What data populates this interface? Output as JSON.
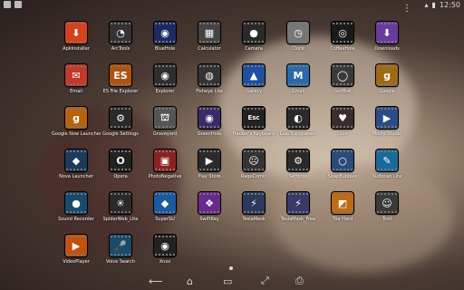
{
  "launcher": {
    "apps": [
      {
        "label": "ApkInstaller",
        "icon": "apk-installer-icon",
        "color": "#d4411a",
        "glyph": "⬇"
      },
      {
        "label": "ArcTools",
        "icon": "arc-tools-icon",
        "color": "#333333",
        "glyph": "◔"
      },
      {
        "label": "BlueHole",
        "icon": "blue-hole-icon",
        "color": "#1e2b63",
        "glyph": "◉"
      },
      {
        "label": "Calculator",
        "icon": "calculator-icon",
        "color": "#444444",
        "glyph": "▦"
      },
      {
        "label": "Camera",
        "icon": "camera-icon",
        "color": "#2a2a2a",
        "glyph": "●"
      },
      {
        "label": "Clock",
        "icon": "clock-icon",
        "color": "#777777",
        "glyph": "◷"
      },
      {
        "label": "CoffeeHole",
        "icon": "coffee-hole-icon",
        "color": "#1a1a1a",
        "glyph": "◎"
      },
      {
        "label": "Downloads",
        "icon": "downloads-icon",
        "color": "#6a3aa0",
        "glyph": "⬇"
      },
      {
        "label": "Email",
        "icon": "email-icon",
        "color": "#c0392b",
        "glyph": "✉"
      },
      {
        "label": "ES File Explorer",
        "icon": "es-file-explorer-icon",
        "color": "#b0520e",
        "glyph": "ES"
      },
      {
        "label": "Explorer",
        "icon": "explorer-icon",
        "color": "#2e2e2e",
        "glyph": "◉"
      },
      {
        "label": "Fisheye Lite",
        "icon": "fisheye-lite-icon",
        "color": "#333333",
        "glyph": "◍"
      },
      {
        "label": "Gallery",
        "icon": "gallery-icon",
        "color": "#1f4f9e",
        "glyph": "▲"
      },
      {
        "label": "Gmail",
        "icon": "gmail-icon",
        "color": "#2b6aa8",
        "glyph": "M"
      },
      {
        "label": "GolfBall",
        "icon": "golf-ball-icon",
        "color": "#3a3a3a",
        "glyph": "◯"
      },
      {
        "label": "Google",
        "icon": "google-icon",
        "color": "#a06a14",
        "glyph": "g"
      },
      {
        "label": "Google Now Launcher",
        "icon": "google-now-launcher-icon",
        "color": "#b8620f",
        "glyph": "g"
      },
      {
        "label": "Google Settings",
        "icon": "google-settings-icon",
        "color": "#2a2a2a",
        "glyph": "⚙"
      },
      {
        "label": "Graveyard",
        "icon": "graveyard-icon",
        "color": "#555555",
        "glyph": "⛫"
      },
      {
        "label": "GreenHole",
        "icon": "green-hole-icon",
        "color": "#3a2a6a",
        "glyph": "◉"
      },
      {
        "label": "Hacker's Keyboard",
        "icon": "hackers-keyboard-icon",
        "color": "#222222",
        "glyph": "Esc"
      },
      {
        "label": "LessTransparent",
        "icon": "less-transparent-icon",
        "color": "#2a2a2a",
        "glyph": "◐"
      },
      {
        "label": "Love",
        "icon": "love-icon",
        "color": "#3a2d2d",
        "glyph": "♥"
      },
      {
        "label": "Movie Studio",
        "icon": "movie-studio-icon",
        "color": "#2a4d8a",
        "glyph": "▶"
      },
      {
        "label": "Nova Launcher",
        "icon": "nova-launcher-icon",
        "color": "#1b3a5c",
        "glyph": "◆"
      },
      {
        "label": "Opera",
        "icon": "opera-icon",
        "color": "#222222",
        "glyph": "O"
      },
      {
        "label": "PhotoNegative",
        "icon": "photo-negative-icon",
        "color": "#8a2222",
        "glyph": "▣"
      },
      {
        "label": "Play Store",
        "icon": "play-store-icon",
        "color": "#2a2a2a",
        "glyph": "▶"
      },
      {
        "label": "RageComic",
        "icon": "rage-comic-icon",
        "color": "#333333",
        "glyph": "☹"
      },
      {
        "label": "Settings",
        "icon": "settings-icon",
        "color": "#2a2a2a",
        "glyph": "⚙"
      },
      {
        "label": "SoapBubbles",
        "icon": "soap-bubbles-icon",
        "color": "#2a4a7a",
        "glyph": "○"
      },
      {
        "label": "Sudocan Lite",
        "icon": "sudocan-lite-icon",
        "color": "#1a6a9a",
        "glyph": "✎"
      },
      {
        "label": "Sound Recorder",
        "icon": "sound-recorder-icon",
        "color": "#1a4a6a",
        "glyph": "●"
      },
      {
        "label": "SpiderWeb_Lite",
        "icon": "spider-web-lite-icon",
        "color": "#2a2a2a",
        "glyph": "✳"
      },
      {
        "label": "SuperSU",
        "icon": "supersu-icon",
        "color": "#1a5aa0",
        "glyph": "◆"
      },
      {
        "label": "SwiftKey",
        "icon": "swiftkey-icon",
        "color": "#6a2a8a",
        "glyph": "❖"
      },
      {
        "label": "TeslaMask",
        "icon": "tesla-mask-icon",
        "color": "#2a3a5a",
        "glyph": "⚡"
      },
      {
        "label": "TeslaMask_Free",
        "icon": "tesla-mask-free-icon",
        "color": "#3a3a6a",
        "glyph": "⚡"
      },
      {
        "label": "Tile Hard",
        "icon": "tile-hard-icon",
        "color": "#c06a14",
        "glyph": "◩"
      },
      {
        "label": "Troll",
        "icon": "troll-icon",
        "color": "#3a3a3a",
        "glyph": "☺"
      },
      {
        "label": "VideoPlayer",
        "icon": "video-player-icon",
        "color": "#c0520e",
        "glyph": "▶"
      },
      {
        "label": "Voice Search",
        "icon": "voice-search-icon",
        "color": "#1a4a6a",
        "glyph": "🎤"
      },
      {
        "label": "Xnxx",
        "icon": "xnxx-icon",
        "color": "#222222",
        "glyph": "◉"
      }
    ]
  },
  "status": {
    "time": "12:50",
    "battery": "battery-icon",
    "wifi": "wifi-icon"
  },
  "navbar": {
    "back": "back-icon",
    "home": "home-icon",
    "recents": "recents-icon",
    "fullscreen": "fullscreen-icon",
    "screenshot": "screenshot-icon"
  }
}
